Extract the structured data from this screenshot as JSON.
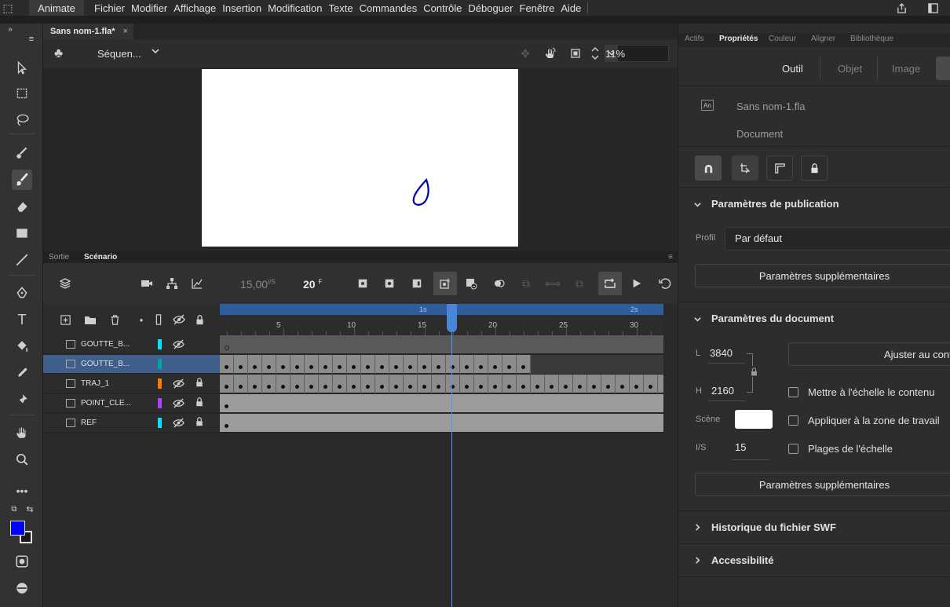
{
  "app": {
    "name": "Animate",
    "menus": [
      "Fichier",
      "Modifier",
      "Affichage",
      "Insertion",
      "Modification",
      "Texte",
      "Commandes",
      "Contrôle",
      "Déboguer",
      "Fenêtre",
      "Aide"
    ]
  },
  "document": {
    "tab_label": "Sans nom-1.fla*",
    "close_glyph": "×"
  },
  "stagebar": {
    "scene_label": "Séquen...",
    "zoom_value": "11%"
  },
  "timeline": {
    "tabs": [
      "Sortie",
      "Scénario"
    ],
    "fps_value": "15,00",
    "fps_unit": "I/S",
    "frame_value": "20",
    "frame_unit": "F",
    "ruler_marks": [
      "1s",
      "2s"
    ],
    "ruler_numbers": [
      "5",
      "10",
      "15",
      "20",
      "25",
      "30"
    ],
    "current_frame": 20,
    "layers": [
      {
        "name": "GOUTTE_B...",
        "color": "#00e5ff",
        "hidden": true,
        "locked": false
      },
      {
        "name": "GOUTTE_B...",
        "color": "#00a0b0",
        "hidden": false,
        "locked": false,
        "selected": true
      },
      {
        "name": "TRAJ_1",
        "color": "#ff7a00",
        "hidden": true,
        "locked": true
      },
      {
        "name": "POINT_CLE...",
        "color": "#b040ff",
        "hidden": true,
        "locked": true
      },
      {
        "name": "REF",
        "color": "#00e5ff",
        "hidden": true,
        "locked": true
      }
    ]
  },
  "properties": {
    "tabs": [
      "Actifs",
      "Propriétés",
      "Couleur",
      "Aligner",
      "Bibliothèque"
    ],
    "subtabs": [
      "Outil",
      "Objet",
      "Image"
    ],
    "doc_type_badge": "An",
    "file_name": "Sans nom-1.fla",
    "file_kind": "Document",
    "publish_section": "Paramètres de publication",
    "profile_label": "Profil",
    "profile_value": "Par défaut",
    "more_settings_1": "Paramètres supplémentaires",
    "document_section": "Paramètres du document",
    "width_label": "L",
    "width_value": "3840",
    "height_label": "H",
    "height_value": "2160",
    "fit_button": "Ajuster au cont",
    "scale_content": "Mettre à l'échelle le contenu",
    "apply_workspace": "Appliquer à la zone de travail",
    "scale_ranges": "Plages de l'échelle",
    "scene_label": "Scène",
    "fps_label": "I/S",
    "fps_value": "15",
    "more_settings_2": "Paramètres supplémentaires",
    "swf_history": "Historique du fichier SWF",
    "accessibility": "Accessibilité"
  },
  "colors": {
    "accent": "#4a9eff",
    "fill_color": "#0000ff",
    "stroke_drop": "#0000aa"
  }
}
